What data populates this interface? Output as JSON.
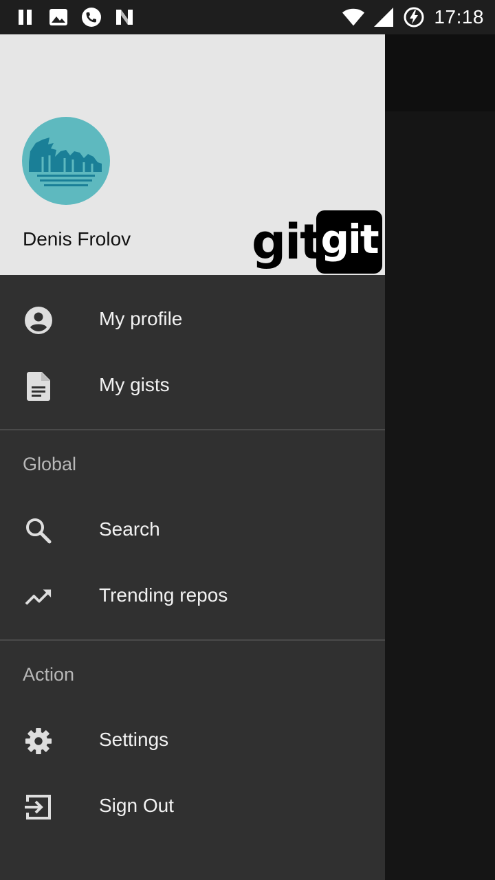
{
  "status_bar": {
    "time": "17:18",
    "left_icons": [
      "pause-icon",
      "image-icon",
      "phone-icon",
      "n-icon"
    ],
    "right_icons": [
      "wifi-icon",
      "signal-icon",
      "battery-charging-icon"
    ]
  },
  "drawer": {
    "header": {
      "username": "Denis Frolov",
      "logo_text": "git",
      "logo_box_text": "git",
      "avatar_color": "#5eb9bf"
    },
    "items_top": [
      {
        "label": "My profile",
        "icon": "account-circle-icon"
      },
      {
        "label": "My gists",
        "icon": "document-icon"
      }
    ],
    "section_global": {
      "title": "Global",
      "items": [
        {
          "label": "Search",
          "icon": "search-icon"
        },
        {
          "label": "Trending repos",
          "icon": "trending-up-icon"
        }
      ]
    },
    "section_action": {
      "title": "Action",
      "items": [
        {
          "label": "Settings",
          "icon": "gear-icon"
        },
        {
          "label": "Sign Out",
          "icon": "sign-out-icon"
        }
      ]
    }
  },
  "colors": {
    "drawer_bg": "#303030",
    "header_bg": "#e6e6e6",
    "text": "#f2f2f2",
    "section_text": "#b8b8b8"
  }
}
